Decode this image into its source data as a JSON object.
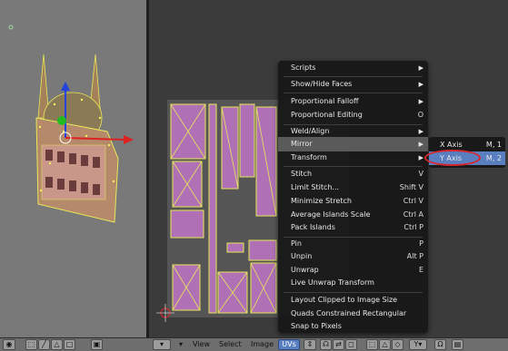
{
  "menu": {
    "items": [
      {
        "label": "Scripts",
        "shortcut": "",
        "submenu": true
      },
      {
        "label": "Show/Hide Faces",
        "shortcut": "",
        "submenu": true
      },
      {
        "label": "Proportional Falloff",
        "shortcut": "",
        "submenu": true
      },
      {
        "label": "Proportional Editing",
        "shortcut": "O",
        "submenu": false
      },
      {
        "label": "Weld/Align",
        "shortcut": "",
        "submenu": true
      },
      {
        "label": "Mirror",
        "shortcut": "",
        "submenu": true
      },
      {
        "label": "Transform",
        "shortcut": "",
        "submenu": true
      },
      {
        "label": "Stitch",
        "shortcut": "V",
        "submenu": false
      },
      {
        "label": "Limit Stitch...",
        "shortcut": "Shift V",
        "submenu": false
      },
      {
        "label": "Minimize Stretch",
        "shortcut": "Ctrl V",
        "submenu": false
      },
      {
        "label": "Average Islands Scale",
        "shortcut": "Ctrl A",
        "submenu": false
      },
      {
        "label": "Pack Islands",
        "shortcut": "Ctrl P",
        "submenu": false
      },
      {
        "label": "Pin",
        "shortcut": "P",
        "submenu": false
      },
      {
        "label": "Unpin",
        "shortcut": "Alt P",
        "submenu": false
      },
      {
        "label": "Unwrap",
        "shortcut": "E",
        "submenu": false
      },
      {
        "label": "Live Unwrap Transform",
        "shortcut": "",
        "submenu": false
      },
      {
        "label": "Layout Clipped to Image Size",
        "shortcut": "",
        "submenu": false
      },
      {
        "label": "Quads Constrained Rectangular",
        "shortcut": "",
        "submenu": false
      },
      {
        "label": "Snap to Pixels",
        "shortcut": "",
        "submenu": false
      }
    ]
  },
  "submenu": {
    "items": [
      {
        "label": "X Axis",
        "shortcut": "M, 1"
      },
      {
        "label": "Y Axis",
        "shortcut": "M, 2"
      }
    ]
  },
  "header": {
    "view": "View",
    "select": "Select",
    "image": "Image",
    "uvs": "UVs"
  },
  "colors": {
    "uv_face": "#b070b6",
    "uv_edge": "#e8e85a",
    "menu_bg": "#171717",
    "highlight": "#5a7fc0",
    "circle": "#d8262c"
  }
}
